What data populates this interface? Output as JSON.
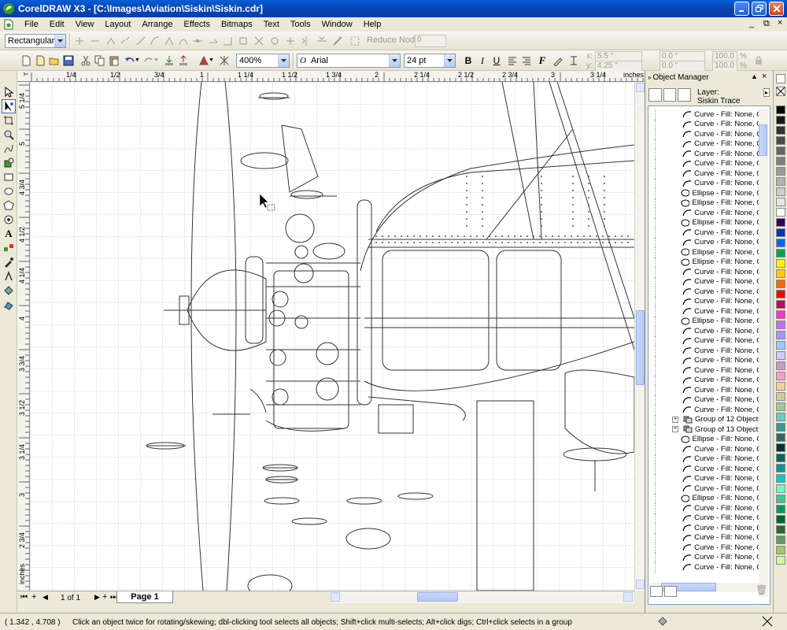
{
  "window": {
    "title": "CorelDRAW X3 - [C:\\Images\\Aviation\\Siskin\\Siskin.cdr]"
  },
  "menu": {
    "items": [
      "File",
      "Edit",
      "View",
      "Layout",
      "Arrange",
      "Effects",
      "Bitmaps",
      "Text",
      "Tools",
      "Window",
      "Help"
    ]
  },
  "property_bar": {
    "shape_type": "Rectangular",
    "reduce_nodes_label": "Reduce Nodes",
    "reduce_nodes_value": "0"
  },
  "standard_bar": {
    "zoom": "400%",
    "font_name": "Arial",
    "font_size": "24 pt",
    "x_value": "5.5 \"",
    "y_value": "4.25 \"",
    "w_value": "0.0 \"",
    "h_value": "0.0 \"",
    "scale_w": "100.0",
    "scale_h": "100.0",
    "pct_sign": "%"
  },
  "ruler": {
    "h_labels": [
      "1/4",
      "1/2",
      "3/4",
      "1",
      "1 1/4",
      "1 1/2",
      "1 3/4",
      "2",
      "2 1/4",
      "2 1/2",
      "2 3/4",
      "3",
      "3 1/4",
      "inches"
    ],
    "v_labels": [
      "5 1/4",
      "5",
      "4 3/4",
      "4 1/2",
      "4 1/4",
      "4",
      "3 3/4",
      "3 1/2",
      "3 1/4",
      "3",
      "2 3/4",
      "inches"
    ]
  },
  "page_nav": {
    "page_count": "1 of 1",
    "page_tab": "Page 1"
  },
  "status": {
    "coordinates": "( 1.342 , 4.708 )",
    "hint": "Click an object twice for rotating/skewing; dbl-clicking tool selects all objects; Shift+click multi-selects; Alt+click digs; Ctrl+click selects in a group"
  },
  "object_manager": {
    "title": "Object Manager",
    "layer_label": "Layer:",
    "layer_name": "Siskin Trace",
    "items": [
      {
        "kind": "curve",
        "label": "Curve - Fill: None, Ou"
      },
      {
        "kind": "curve",
        "label": "Curve - Fill: None, Ou"
      },
      {
        "kind": "curve",
        "label": "Curve - Fill: None, Ou"
      },
      {
        "kind": "curve",
        "label": "Curve - Fill: None, Ou"
      },
      {
        "kind": "curve",
        "label": "Curve - Fill: None, Ou"
      },
      {
        "kind": "curve",
        "label": "Curve - Fill: None, Ou"
      },
      {
        "kind": "curve",
        "label": "Curve - Fill: None, Ou"
      },
      {
        "kind": "curve",
        "label": "Curve - Fill: None, Ou"
      },
      {
        "kind": "ellipse",
        "label": "Ellipse - Fill: None, Ou"
      },
      {
        "kind": "ellipse",
        "label": "Ellipse - Fill: None, Ou"
      },
      {
        "kind": "curve",
        "label": "Curve - Fill: None, Ou"
      },
      {
        "kind": "ellipse",
        "label": "Ellipse - Fill: None, Ou"
      },
      {
        "kind": "curve",
        "label": "Curve - Fill: None, Ou"
      },
      {
        "kind": "curve",
        "label": "Curve - Fill: None, Ou"
      },
      {
        "kind": "ellipse",
        "label": "Ellipse - Fill: None, Ou"
      },
      {
        "kind": "ellipse",
        "label": "Ellipse - Fill: None, Ou"
      },
      {
        "kind": "curve",
        "label": "Curve - Fill: None, Ou"
      },
      {
        "kind": "curve",
        "label": "Curve - Fill: None, Ou"
      },
      {
        "kind": "curve",
        "label": "Curve - Fill: None, Ou"
      },
      {
        "kind": "curve",
        "label": "Curve - Fill: None, Ou"
      },
      {
        "kind": "curve",
        "label": "Curve - Fill: None, Ou"
      },
      {
        "kind": "ellipse",
        "label": "Ellipse - Fill: None, Ou"
      },
      {
        "kind": "curve",
        "label": "Curve - Fill: None, Ou"
      },
      {
        "kind": "curve",
        "label": "Curve - Fill: None, Ou"
      },
      {
        "kind": "curve",
        "label": "Curve - Fill: None, Ou"
      },
      {
        "kind": "curve",
        "label": "Curve - Fill: None, Ou"
      },
      {
        "kind": "curve",
        "label": "Curve - Fill: None, Ou"
      },
      {
        "kind": "curve",
        "label": "Curve - Fill: None, Ou"
      },
      {
        "kind": "curve",
        "label": "Curve - Fill: None, Ou"
      },
      {
        "kind": "curve",
        "label": "Curve - Fill: None, Ou"
      },
      {
        "kind": "curve",
        "label": "Curve - Fill: None, Ou"
      },
      {
        "kind": "group",
        "label": "Group of 12 Objects"
      },
      {
        "kind": "group",
        "label": "Group of 13 Objects"
      },
      {
        "kind": "ellipse",
        "label": "Ellipse - Fill: None, Ou"
      },
      {
        "kind": "curve",
        "label": "Curve - Fill: None, Ou"
      },
      {
        "kind": "curve",
        "label": "Curve - Fill: None, Ou"
      },
      {
        "kind": "curve",
        "label": "Curve - Fill: None, Ou"
      },
      {
        "kind": "curve",
        "label": "Curve - Fill: None, Ou"
      },
      {
        "kind": "curve",
        "label": "Curve - Fill: None, Ou"
      },
      {
        "kind": "ellipse",
        "label": "Ellipse - Fill: None, Ou"
      },
      {
        "kind": "curve",
        "label": "Curve - Fill: None, Ou"
      },
      {
        "kind": "curve",
        "label": "Curve - Fill: None, Ou"
      },
      {
        "kind": "curve",
        "label": "Curve - Fill: None, Ou"
      },
      {
        "kind": "curve",
        "label": "Curve - Fill: None, Ou"
      },
      {
        "kind": "curve",
        "label": "Curve - Fill: None, Ou"
      },
      {
        "kind": "curve",
        "label": "Curve - Fill: None, Ou"
      },
      {
        "kind": "curve",
        "label": "Curve - Fill: None, Ou"
      }
    ]
  },
  "palette": {
    "colors": [
      "#000000",
      "#1a1a1a",
      "#333333",
      "#4d4d4d",
      "#666666",
      "#808080",
      "#999999",
      "#b3b3b3",
      "#cccccc",
      "#e6e6e6",
      "#ffffff",
      "#330066",
      "#0033cc",
      "#0066ff",
      "#00a651",
      "#fff200",
      "#ffcc00",
      "#ff6600",
      "#ff0000",
      "#cc0066",
      "#ff33cc",
      "#cc66ff",
      "#9999ff",
      "#99ccff",
      "#ccccff",
      "#cc99cc",
      "#ff99cc",
      "#ffcc99",
      "#cccc99",
      "#99cc99",
      "#66cccc",
      "#339999",
      "#336666",
      "#003333",
      "#006666",
      "#009999",
      "#00cccc",
      "#66ffcc",
      "#33cc99",
      "#009966",
      "#006633",
      "#336633",
      "#669966",
      "#99cc66",
      "#ccff99"
    ]
  },
  "colors": {
    "title_bar": "#0845b9",
    "canvas": "#ffffff",
    "chrome": "#ece9d8"
  }
}
